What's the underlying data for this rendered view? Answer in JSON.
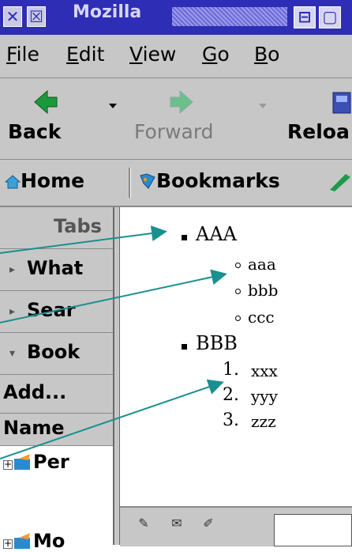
{
  "window": {
    "title": "Mozilla"
  },
  "menubar": {
    "items": [
      {
        "label": "File",
        "mnemonic": "F",
        "rest": "ile"
      },
      {
        "label": "Edit",
        "mnemonic": "E",
        "rest": "dit"
      },
      {
        "label": "View",
        "mnemonic": "V",
        "rest": "iew"
      },
      {
        "label": "Go",
        "mnemonic": "G",
        "rest": "o"
      },
      {
        "label": "Bo",
        "mnemonic": "B",
        "rest": "o"
      }
    ]
  },
  "navbar": {
    "back": "Back",
    "forward": "Forward",
    "reload": "Reloa"
  },
  "personalbar": {
    "home": "Home",
    "bookmarks": "Bookmarks"
  },
  "sidebar": {
    "tabs_header": "Tabs",
    "panels": [
      "What",
      "Sear",
      "Book"
    ],
    "add_button": "Add...",
    "column_name": "Name",
    "tree_items": [
      "Per",
      "Mo"
    ]
  },
  "content": {
    "list": [
      {
        "label": "AAA",
        "children": [
          "aaa",
          "bbb",
          "ccc"
        ]
      },
      {
        "label": "BBB",
        "children": [
          "xxx",
          "yyy",
          "zzz"
        ]
      }
    ],
    "ordered_markers": [
      "1.",
      "2.",
      "3."
    ]
  },
  "colors": {
    "titlebar": "#2e2db5",
    "chrome": "#c7c7c7",
    "arrows": "#1a8f8f"
  }
}
